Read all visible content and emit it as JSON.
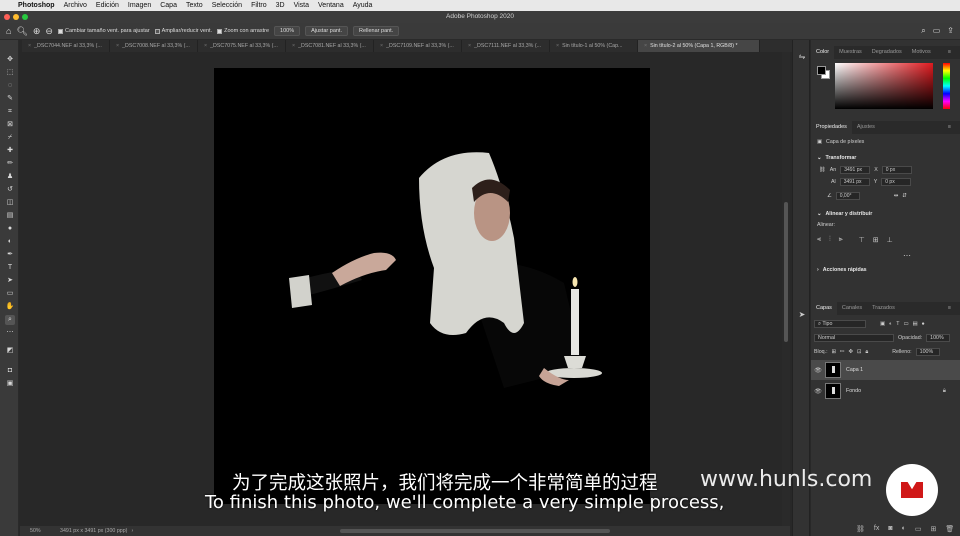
{
  "menubar": {
    "items": [
      "Photoshop",
      "Archivo",
      "Edición",
      "Imagen",
      "Capa",
      "Texto",
      "Selección",
      "Filtro",
      "3D",
      "Vista",
      "Ventana",
      "Ayuda"
    ]
  },
  "window": {
    "title": "Adobe Photoshop 2020"
  },
  "options_bar": {
    "resize_windows": "Cambiar tamaño vent. para ajustar",
    "zoom_all_windows": "Ampliar/reducir vent.",
    "scrubby_zoom": "Zoom con arrastre",
    "zoom_value": "100%",
    "fit_screen": "Ajustar pant.",
    "fill_screen": "Rellenar pant."
  },
  "tabs": [
    "_DSC7044.NEF al 33,3% (...",
    "_DSC7008.NEF al 33,3% (...",
    "_DSC7075.NEF al 33,3% (...",
    "_DSC7081.NEF al 33,3% (...",
    "_DSC7109.NEF al 33,3% (...",
    "_DSC7111.NEF al 33,3% (...",
    "Sin título-1 al 50% (Cap...",
    "Sin título-2 al 50% (Capa 1, RGB/8) *"
  ],
  "status": {
    "zoom": "50%",
    "doc_info": "3491 px x 3491 px (300 ppp)"
  },
  "color_panel": {
    "tabs": [
      "Color",
      "Muestras",
      "Degradados",
      "Motivos"
    ],
    "accent": "#e01a1f"
  },
  "properties_panel": {
    "tabs": [
      "Propiedades",
      "Ajustes"
    ],
    "layer_type": "Capa de píxeles",
    "transform_header": "Transformar",
    "width_label": "An",
    "width_value": "3491 px",
    "height_label": "Al",
    "height_value": "3491 px",
    "x_label": "X",
    "x_value": "0 px",
    "y_label": "Y",
    "y_value": "0 px",
    "angle_value": "0,00°",
    "align_header": "Alinear y distribuir",
    "align_label": "Alinear:",
    "quick_actions": "Acciones rápidas"
  },
  "layers_panel": {
    "tabs": [
      "Capas",
      "Canales",
      "Trazados"
    ],
    "filter": "Tipo",
    "blend_mode": "Normal",
    "opacity_label": "Opacidad:",
    "opacity_value": "100%",
    "lock_label": "Bloq.:",
    "fill_label": "Relleno:",
    "fill_value": "100%",
    "layers": [
      "Capa 1",
      "Fondo"
    ]
  },
  "subtitles": {
    "chinese": "为了完成这张照片，我们将完成一个非常简单的过程",
    "english": "To finish this photo, we'll complete a very simple process,"
  },
  "watermark": "www.hunls.com"
}
